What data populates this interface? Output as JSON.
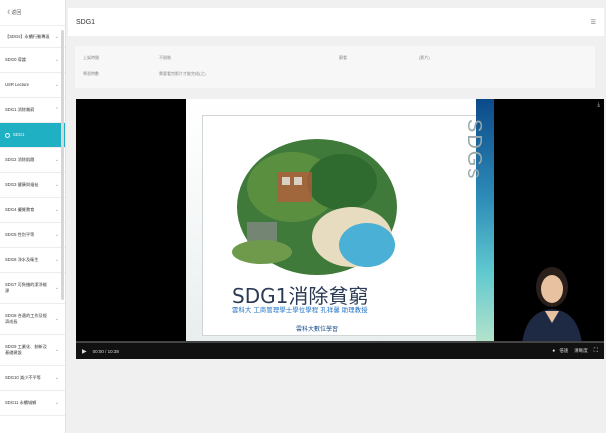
{
  "sidebar": {
    "back_label": "《 返回",
    "items": [
      {
        "label": "【SDGs】永續行動專區",
        "chevron": "⌄",
        "active": false
      },
      {
        "label": "SDG0 導論",
        "chevron": "⌄",
        "active": false
      },
      {
        "label": "USR Lecture",
        "chevron": "⌄",
        "active": false
      },
      {
        "label": "SDG1 消除貧窮",
        "chevron": "⌃",
        "active": false
      },
      {
        "label": "SDG1",
        "chevron": "",
        "active": true
      },
      {
        "label": "SDG2 消除飢餓",
        "chevron": "⌄",
        "active": false
      },
      {
        "label": "SDG3 健康與福祉",
        "chevron": "⌄",
        "active": false
      },
      {
        "label": "SDG4 優質教育",
        "chevron": "⌄",
        "active": false
      },
      {
        "label": "SDG5 性別平等",
        "chevron": "⌄",
        "active": false
      },
      {
        "label": "SDG6 淨水及衛生",
        "chevron": "⌄",
        "active": false
      },
      {
        "label": "SDG7 可負擔的潔淨能源",
        "chevron": "⌄",
        "active": false
      },
      {
        "label": "SDG8 合適的工作及經濟成長",
        "chevron": "⌄",
        "active": false
      },
      {
        "label": "SDG9 工業化、創新及基礎建設",
        "chevron": "⌄",
        "active": false
      },
      {
        "label": "SDG10 減少不平等",
        "chevron": "⌄",
        "active": false
      },
      {
        "label": "SDG11 永續城鄉",
        "chevron": "⌄",
        "active": false
      }
    ]
  },
  "header": {
    "title": "SDG1",
    "menu_icon": "☰"
  },
  "info": {
    "label1": "上架時間",
    "value1": "不限制",
    "label2": "觀看",
    "value3": "(影片)",
    "label4": "學習時數",
    "value4": "需要看完影片才能完成(之)"
  },
  "video": {
    "time": "00:00 / 10:38",
    "progress": 0.0,
    "speed": "倍速",
    "quality": "清晰度",
    "download_icon": "download-icon"
  },
  "slide": {
    "title": "SDG1消除貧窮",
    "subtitle": "雲科大 工商管理學士學位學程 孔祥馨 助理教授",
    "subtitle2": "雲科大數位學習"
  }
}
